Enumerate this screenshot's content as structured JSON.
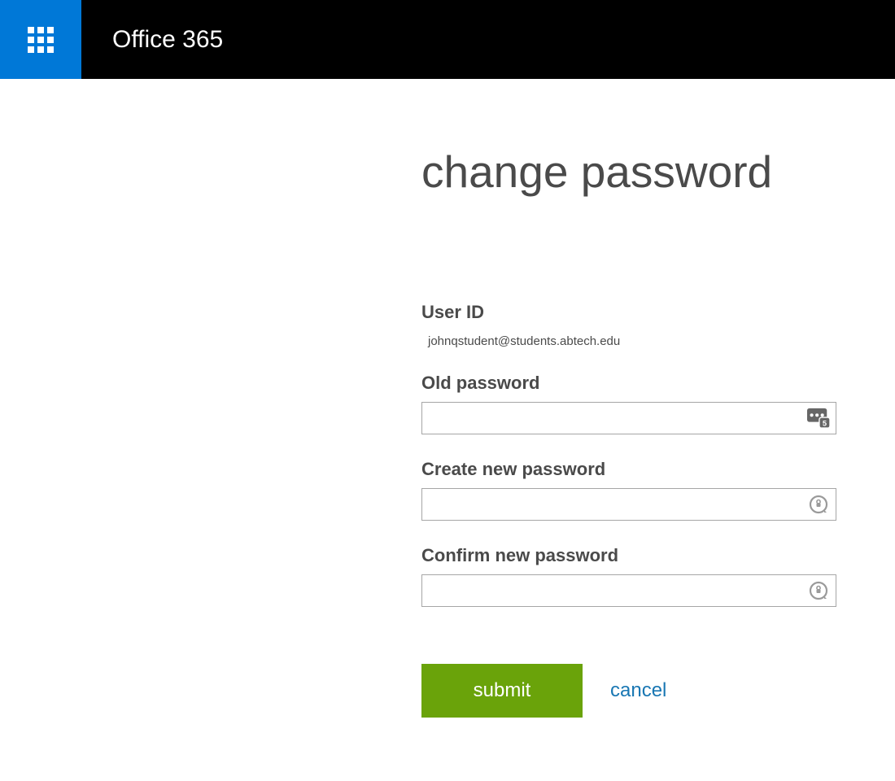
{
  "header": {
    "brand": "Office 365"
  },
  "page": {
    "title": "change password"
  },
  "form": {
    "user_id_label": "User ID",
    "user_id_value": "johnqstudent@students.abtech.edu",
    "old_password_label": "Old password",
    "old_password_value": "",
    "new_password_label": "Create new password",
    "new_password_value": "",
    "confirm_password_label": "Confirm new password",
    "confirm_password_value": "",
    "submit_label": "submit",
    "cancel_label": "cancel"
  }
}
